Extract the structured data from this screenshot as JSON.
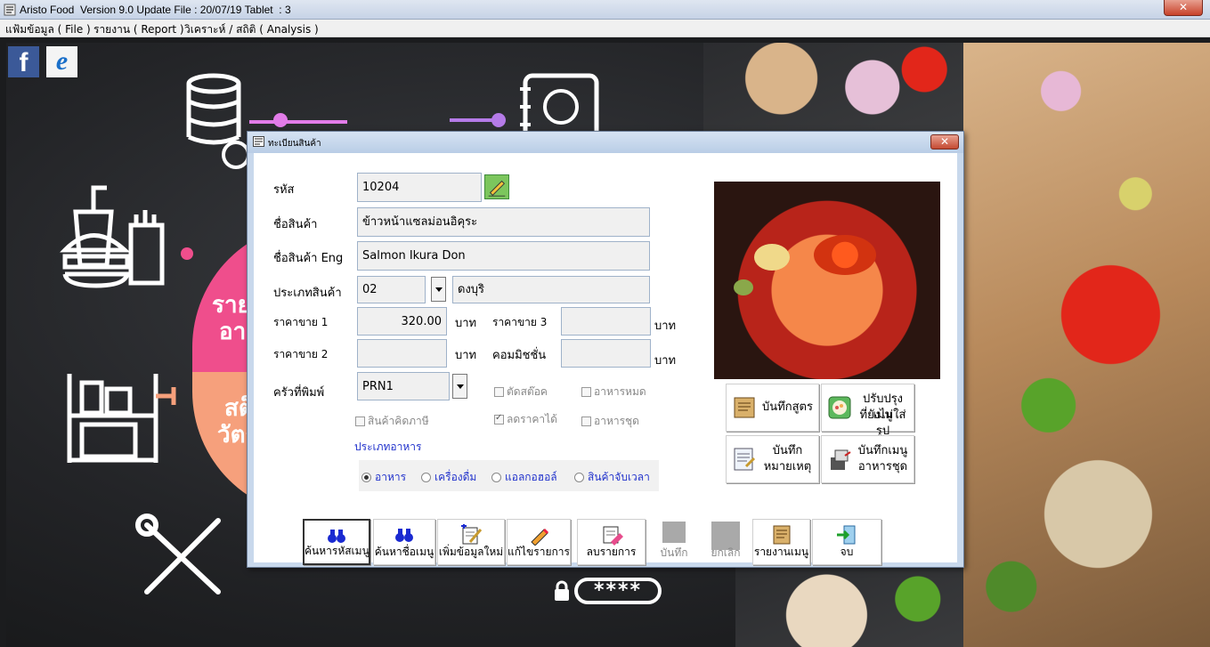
{
  "window": {
    "title": "Aristo Food  Version 9.0 Update File : 20/07/19 Tablet  : 3",
    "close_label": "✕"
  },
  "menu": [
    {
      "label": "แฟ้มข้อมูล ( File )"
    },
    {
      "label": "รายงาน ( Report )"
    },
    {
      "label": "วิเคราะห์ / สถิติ ( Analysis )"
    }
  ],
  "background": {
    "fb_label": "f",
    "ie_label": "e",
    "half_top_text": "รายงาน",
    "half_top_text2": "อาหาร",
    "half_bot_text": "สต็อก",
    "half_bot_text2": "วัตถุดิบ",
    "password_mask": "****"
  },
  "dialog": {
    "title": "ทะเบียนสินค้า",
    "close_label": "✕",
    "labels": {
      "code": "รหัส",
      "name": "ชื่อสินค้า",
      "name_eng": "ชื่อสินค้า Eng",
      "category": "ประเภทสินค้า",
      "price1": "ราคาขาย 1",
      "price2": "ราคาขาย 2",
      "price3": "ราคาขาย 3",
      "commission": "คอมมิชชั่น",
      "printer": "ครัวที่พิมพ์",
      "baht": "บาท",
      "food_type": "ประเภทอาหาร"
    },
    "values": {
      "code": "10204",
      "name": "ข้าวหน้าแซลม่อนอิคุระ",
      "name_eng": "Salmon Ikura Don",
      "category_code": "02",
      "category_name": "ดงบุริ",
      "price1": "320.00",
      "price2": "",
      "price3": "",
      "commission": "",
      "printer": "PRN1"
    },
    "checkboxes": [
      {
        "label": "ตัดสต๊อค",
        "checked": false
      },
      {
        "label": "อาหารหมด",
        "checked": false
      },
      {
        "label": "สินค้าคิดภาษี",
        "checked": false
      },
      {
        "label": "ลดราคาได้",
        "checked": true
      },
      {
        "label": "อาหารชุด",
        "checked": false
      }
    ],
    "radios": [
      {
        "label": "อาหาร",
        "selected": true
      },
      {
        "label": "เครื่องดื่ม",
        "selected": false
      },
      {
        "label": "แอลกอฮอล์",
        "selected": false
      },
      {
        "label": "สินค้าจับเวลา",
        "selected": false
      }
    ],
    "side_buttons": [
      {
        "label1": "บันทึกสูตร",
        "label2": ""
      },
      {
        "label1": "ปรับปรุงเมนู",
        "label2": "ที่ยังไม่ใส่รูป"
      },
      {
        "label1": "บันทึก",
        "label2": "หมายเหตุ"
      },
      {
        "label1": "บันทึกเมนู",
        "label2": "อาหารชุด"
      }
    ],
    "toolbar": [
      {
        "label": "ค้นหารหัสเมนู",
        "icon": "binoculars-icon",
        "active": true,
        "enabled": true
      },
      {
        "label": "ค้นหาชื่อเมนู",
        "icon": "binoculars-icon",
        "active": false,
        "enabled": true
      },
      {
        "label": "เพิ่มข้อมูลใหม่",
        "icon": "add-document-icon",
        "active": false,
        "enabled": true
      },
      {
        "label": "แก้ไขรายการ",
        "icon": "pencil-icon",
        "active": false,
        "enabled": true
      },
      {
        "label": "ลบรายการ",
        "icon": "eraser-icon",
        "active": false,
        "enabled": true
      },
      {
        "label": "บันทึก",
        "icon": "disabled-square-icon",
        "active": false,
        "enabled": false
      },
      {
        "label": "ยกเลิก",
        "icon": "disabled-square-icon",
        "active": false,
        "enabled": false
      },
      {
        "label": "รายงานเมนู",
        "icon": "scroll-report-icon",
        "active": false,
        "enabled": true
      },
      {
        "label": "จบ",
        "icon": "exit-door-icon",
        "active": false,
        "enabled": true
      }
    ]
  }
}
